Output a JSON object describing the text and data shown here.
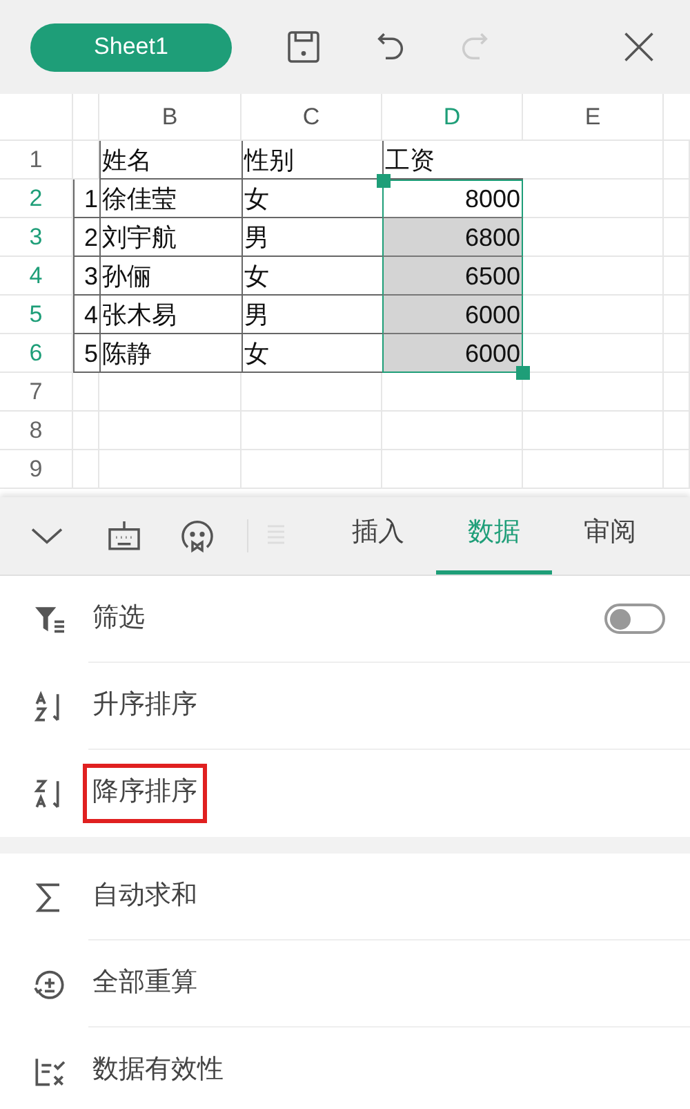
{
  "top_bar": {
    "sheet_tab": "Sheet1",
    "redo_disabled": true
  },
  "grid": {
    "columns": [
      {
        "label": "B",
        "selected": false
      },
      {
        "label": "C",
        "selected": false
      },
      {
        "label": "D",
        "selected": true
      },
      {
        "label": "E",
        "selected": false
      }
    ],
    "rows": [
      {
        "number": "1",
        "selected": false,
        "cells": [
          null,
          {
            "kind": "text",
            "text": "姓名",
            "selected": false
          },
          {
            "kind": "text",
            "text": "性别",
            "selected": false
          },
          {
            "kind": "text",
            "text": "工资",
            "selected": false
          }
        ]
      },
      {
        "number": "2",
        "selected": true,
        "cells": [
          {
            "kind": "number",
            "text": "1",
            "selected": false
          },
          {
            "kind": "text",
            "text": "徐佳莹",
            "selected": false
          },
          {
            "kind": "text",
            "text": "女",
            "selected": false
          },
          {
            "kind": "number",
            "text": "8000",
            "selected": true,
            "active": true
          }
        ]
      },
      {
        "number": "3",
        "selected": true,
        "cells": [
          {
            "kind": "number",
            "text": "2",
            "selected": false
          },
          {
            "kind": "text",
            "text": "刘宇航",
            "selected": false
          },
          {
            "kind": "text",
            "text": "男",
            "selected": false
          },
          {
            "kind": "number",
            "text": "6800",
            "selected": true,
            "active": false
          }
        ]
      },
      {
        "number": "4",
        "selected": true,
        "cells": [
          {
            "kind": "number",
            "text": "3",
            "selected": false
          },
          {
            "kind": "text",
            "text": "孙俪",
            "selected": false
          },
          {
            "kind": "text",
            "text": "女",
            "selected": false
          },
          {
            "kind": "number",
            "text": "6500",
            "selected": true,
            "active": false
          }
        ]
      },
      {
        "number": "5",
        "selected": true,
        "cells": [
          {
            "kind": "number",
            "text": "4",
            "selected": false
          },
          {
            "kind": "text",
            "text": "张木易",
            "selected": false
          },
          {
            "kind": "text",
            "text": "男",
            "selected": false
          },
          {
            "kind": "number",
            "text": "6000",
            "selected": true,
            "active": false
          }
        ]
      },
      {
        "number": "6",
        "selected": true,
        "cells": [
          {
            "kind": "number",
            "text": "5",
            "selected": false
          },
          {
            "kind": "text",
            "text": "陈静",
            "selected": false
          },
          {
            "kind": "text",
            "text": "女",
            "selected": false
          },
          {
            "kind": "number",
            "text": "6000",
            "selected": true,
            "active": false
          }
        ]
      },
      {
        "number": "7",
        "selected": false
      },
      {
        "number": "8",
        "selected": false
      },
      {
        "number": "9",
        "selected": false
      }
    ]
  },
  "ribbon": {
    "tabs": [
      {
        "label": "插入",
        "selected": false
      },
      {
        "label": "数据",
        "selected": true
      },
      {
        "label": "审阅",
        "selected": false
      }
    ]
  },
  "menu_sections": [
    {
      "items": [
        {
          "kind": "toggle",
          "label": "筛选",
          "on": false
        },
        {
          "kind": "action",
          "label": "升序排序",
          "highlighted": false
        },
        {
          "kind": "action",
          "label": "降序排序",
          "highlighted": true
        }
      ]
    },
    {
      "items": [
        {
          "kind": "action",
          "label": "自动求和",
          "highlighted": false
        },
        {
          "kind": "action",
          "label": "全部重算",
          "highlighted": false
        },
        {
          "kind": "action",
          "label": "数据有效性",
          "highlighted": false
        }
      ]
    }
  ]
}
